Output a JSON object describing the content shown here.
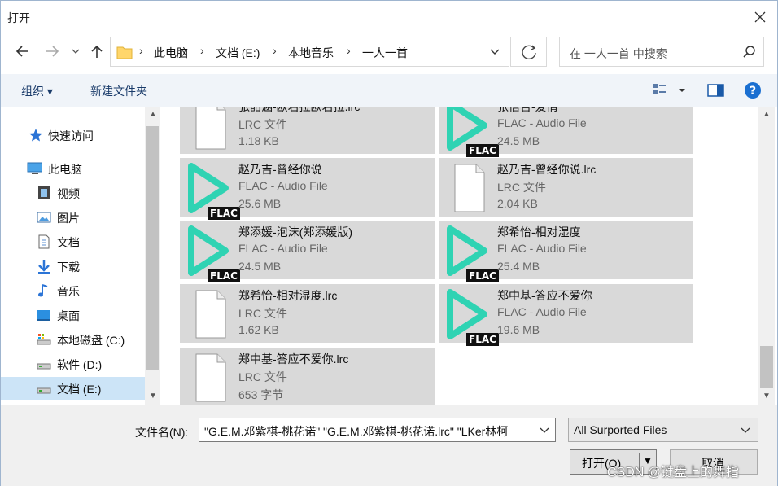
{
  "window": {
    "title": "打开"
  },
  "address": {
    "crumbs": [
      "此电脑",
      "文档 (E:)",
      "本地音乐",
      "一人一首"
    ],
    "search_placeholder": "在 一人一首 中搜索"
  },
  "toolbar": {
    "organize": "组织 ▾",
    "new_folder": "新建文件夹"
  },
  "nav": {
    "quick_access": "快速访问",
    "this_pc": "此电脑",
    "items": [
      "视频",
      "图片",
      "文档",
      "下载",
      "音乐",
      "桌面",
      "本地磁盘 (C:)",
      "软件 (D:)",
      "文档 (E:)"
    ]
  },
  "files": [
    {
      "name": "张韶涵-欧若拉欧若拉.lrc",
      "type": "LRC 文件",
      "size": "1.18 KB",
      "kind": "lrc"
    },
    {
      "name": "张信哲-爱情",
      "type": "FLAC - Audio File",
      "size": "24.5 MB",
      "kind": "flac"
    },
    {
      "name": "赵乃吉-曾经你说",
      "type": "FLAC - Audio File",
      "size": "25.6 MB",
      "kind": "flac"
    },
    {
      "name": "赵乃吉-曾经你说.lrc",
      "type": "LRC 文件",
      "size": "2.04 KB",
      "kind": "lrc"
    },
    {
      "name": "郑添媛-泡沫(郑添媛版)",
      "type": "FLAC - Audio File",
      "size": "24.5 MB",
      "kind": "flac"
    },
    {
      "name": "郑希怡-相对湿度",
      "type": "FLAC - Audio File",
      "size": "25.4 MB",
      "kind": "flac"
    },
    {
      "name": "郑希怡-相对湿度.lrc",
      "type": "LRC 文件",
      "size": "1.62 KB",
      "kind": "lrc"
    },
    {
      "name": "郑中基-答应不爱你",
      "type": "FLAC - Audio File",
      "size": "19.6 MB",
      "kind": "flac"
    },
    {
      "name": "郑中基-答应不爱你.lrc",
      "type": "LRC 文件",
      "size": "653 字节",
      "kind": "lrc"
    }
  ],
  "flac_badge": "FLAC",
  "bottom": {
    "filename_label": "文件名(N):",
    "filename_value": "\"G.E.M.邓紫棋-桃花诺\" \"G.E.M.邓紫棋-桃花诺.lrc\" \"LKer林柯",
    "filter_value": "All Surported Files",
    "open_label": "打开(O)",
    "cancel_label": "取消"
  },
  "watermark": "CSDN @键盘上的舞指",
  "colors": {
    "flac_accent": "#2fd3b3",
    "selected_nav": "#cce4f7",
    "tile_bg": "#d9d9d9"
  }
}
